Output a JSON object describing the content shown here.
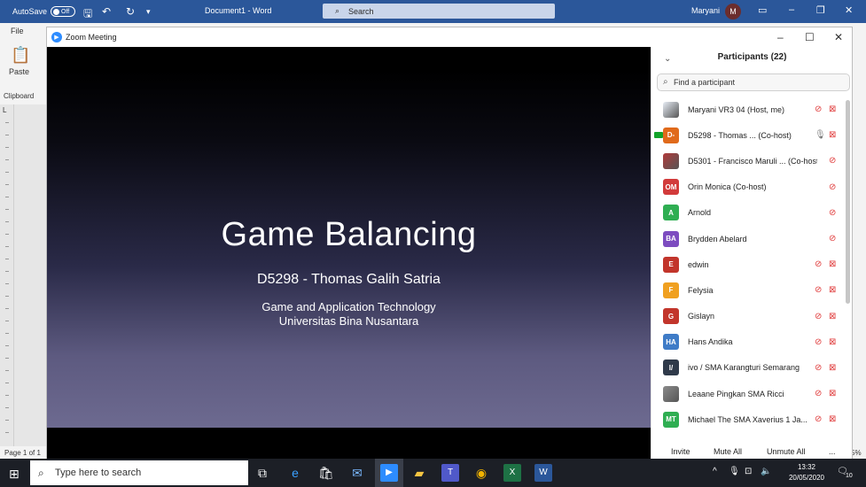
{
  "word": {
    "autosave_label": "AutoSave",
    "autosave_state": "Off",
    "doc_title": "Document1  -  Word",
    "search_placeholder": "Search",
    "user_name": "Maryani",
    "user_initial": "M",
    "file_tab": "File",
    "paste_label": "Paste",
    "clipboard_label": "Clipboard",
    "ruler_marker": "L",
    "status_page": "Page 1 of 1",
    "zoom_percent": "5%"
  },
  "zoom": {
    "window_title": "Zoom Meeting",
    "slide": {
      "title": "Game Balancing",
      "subtitle": "D5298 - Thomas Galih Satria",
      "org_line1": "Game and Application Technology",
      "org_line2": "Universitas Bina Nusantara"
    },
    "panel": {
      "title": "Participants (22)",
      "search_placeholder": "Find a participant",
      "participants": [
        {
          "initials": "",
          "name": "Maryani VR3 04 (Host, me)",
          "color": "#e8eef6",
          "mic": "muted",
          "cam": "off",
          "avatar_type": "image"
        },
        {
          "initials": "D-",
          "name": "D5298 - Thomas ...  (Co-host)",
          "color": "#e06a1b",
          "mic": "on",
          "cam": "off",
          "sharing": true
        },
        {
          "initials": "",
          "name": "D5301 - Francisco Maruli ...  (Co-host)",
          "color": "#b23a3a",
          "mic": "muted",
          "cam": "none",
          "avatar_type": "image"
        },
        {
          "initials": "OM",
          "name": "Orin Monica (Co-host)",
          "color": "#d23b3b",
          "mic": "muted",
          "cam": "none"
        },
        {
          "initials": "A",
          "name": "Arnold",
          "color": "#2fae52",
          "mic": "muted",
          "cam": "none"
        },
        {
          "initials": "BA",
          "name": "Brydden Abelard",
          "color": "#7d4cc0",
          "mic": "muted",
          "cam": "none"
        },
        {
          "initials": "E",
          "name": "edwin",
          "color": "#c2352b",
          "mic": "muted",
          "cam": "off"
        },
        {
          "initials": "F",
          "name": "Felysia",
          "color": "#f0a020",
          "mic": "muted",
          "cam": "off"
        },
        {
          "initials": "G",
          "name": "Gislayn",
          "color": "#c2352b",
          "mic": "muted",
          "cam": "off"
        },
        {
          "initials": "HA",
          "name": "Hans Andika",
          "color": "#3f7cc7",
          "mic": "muted",
          "cam": "off"
        },
        {
          "initials": "I/",
          "name": "ivo / SMA Karangturi Semarang",
          "color": "#2f3a4a",
          "mic": "muted",
          "cam": "off"
        },
        {
          "initials": "",
          "name": "Leaane Pingkan SMA Ricci",
          "color": "#8b8b8b",
          "mic": "muted",
          "cam": "off",
          "avatar_type": "image"
        },
        {
          "initials": "MT",
          "name": "Michael The SMA Xaverius 1 Ja...",
          "color": "#2fae52",
          "mic": "muted",
          "cam": "off"
        }
      ],
      "footer": {
        "invite": "Invite",
        "mute_all": "Mute All",
        "unmute_all": "Unmute All",
        "more": "..."
      }
    }
  },
  "taskbar": {
    "search_placeholder": "Type here to search",
    "time": "13:32",
    "date": "20/05/2020",
    "notification_count": "10"
  },
  "icons": {
    "mic_muted": "mic-muted-icon",
    "cam_off": "camera-off-icon"
  }
}
